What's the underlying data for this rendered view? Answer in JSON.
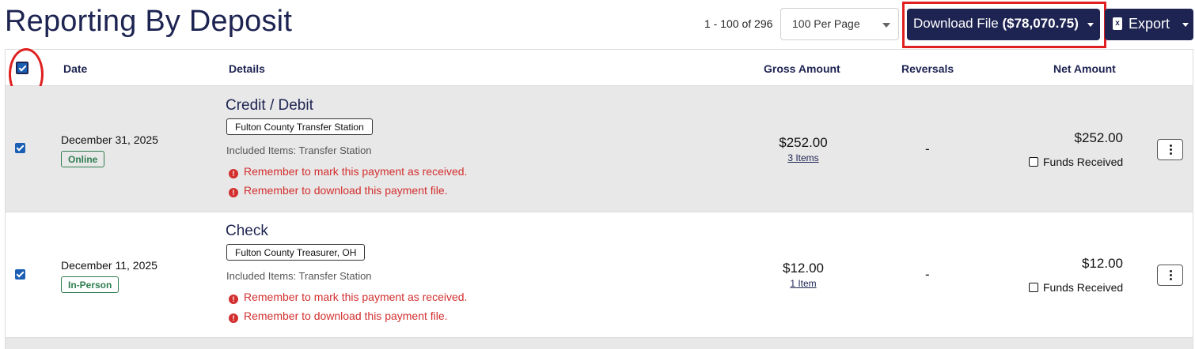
{
  "header": {
    "title": "Reporting By Deposit",
    "pager_text": "1 - 100 of 296",
    "per_page": "100 Per Page",
    "download_label": "Download File",
    "download_amount": "($78,070.75)",
    "export_label": "Export"
  },
  "table": {
    "columns": {
      "date": "Date",
      "details": "Details",
      "gross": "Gross Amount",
      "reversals": "Reversals",
      "net": "Net Amount"
    },
    "rows": [
      {
        "date": "December 31, 2025",
        "channel": "Online",
        "method": "Credit / Debit",
        "location": "Fulton County Transfer Station",
        "included": "Included Items: Transfer Station",
        "warnings": [
          "Remember to mark this payment as received.",
          "Remember to download this payment file."
        ],
        "gross": "$252.00",
        "items": "3 Items",
        "reversals": "-",
        "net": "$252.00",
        "funds_label": "Funds Received"
      },
      {
        "date": "December 11, 2025",
        "channel": "In-Person",
        "method": "Check",
        "location": "Fulton County Treasurer, OH",
        "included": "Included Items: Transfer Station",
        "warnings": [
          "Remember to mark this payment as received.",
          "Remember to download this payment file."
        ],
        "gross": "$12.00",
        "items": "1 Item",
        "reversals": "-",
        "net": "$12.00",
        "funds_label": "Funds Received"
      }
    ]
  },
  "icons": {
    "export": "excel-file-icon",
    "warning": "exclamation-circle-icon",
    "menu": "kebab-menu-icon"
  },
  "colors": {
    "brand": "#1e2452",
    "warning": "#d32f2f",
    "tag_green": "#2e7d4f",
    "highlight": "#e02020"
  }
}
